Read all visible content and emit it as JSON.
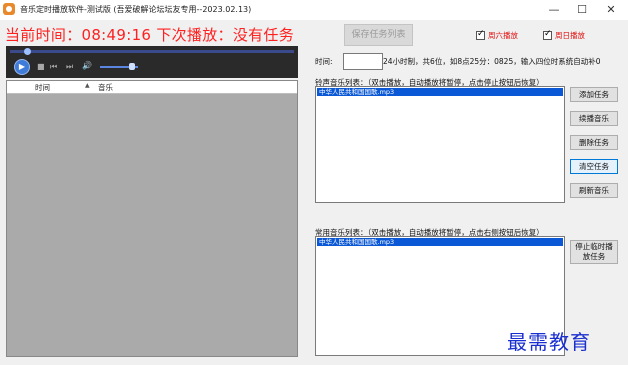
{
  "window": {
    "title": "音乐定时播放软件-测试版 (吾爱破解论坛坛友专用--2023.02.13)",
    "min_label": "—",
    "max_label": "☐",
    "close_label": "✕"
  },
  "header": {
    "clock_line": "当前时间：08:49:16 下次播放：没有任务",
    "save_task_list_label": "保存任务列表",
    "saturday_label": "周六播放",
    "saturday_checked": true,
    "sunday_label": "周日播放",
    "sunday_checked": true
  },
  "player": {
    "play_icon": "▶",
    "stop_icon": "■",
    "prev_icon": "⏮",
    "next_icon": "⏭",
    "volume_icon": "🔊",
    "seek_fraction": 0.05,
    "volume_fraction": 0.85
  },
  "playlist": {
    "col_time": "时间",
    "col_music": "音乐",
    "sort_icon": "▲"
  },
  "schedule": {
    "time_label": "时间:",
    "time_value": "",
    "hint": "24小时制，共6位，如8点25分：0825，输入四位时系统自动补0"
  },
  "bell_list": {
    "label": "铃声音乐列表：（双击播放，自动播放将暂停，点击停止按钮后恢复）",
    "items": [
      "中华人民共和国国歌.mp3"
    ]
  },
  "common_list": {
    "label": "常用音乐列表：（双击播放，自动播放将暂停，点击右侧按钮后恢复）",
    "items": [
      "中华人民共和国国歌.mp3"
    ]
  },
  "buttons": {
    "add_task": "添加任务",
    "continue_music": "续播音乐",
    "delete_task": "删除任务",
    "clear_tasks": "清空任务",
    "refresh_music": "刷新音乐",
    "stop_temp_line1": "停止临时播",
    "stop_temp_line2": "放任务"
  },
  "watermark": "最需教育"
}
